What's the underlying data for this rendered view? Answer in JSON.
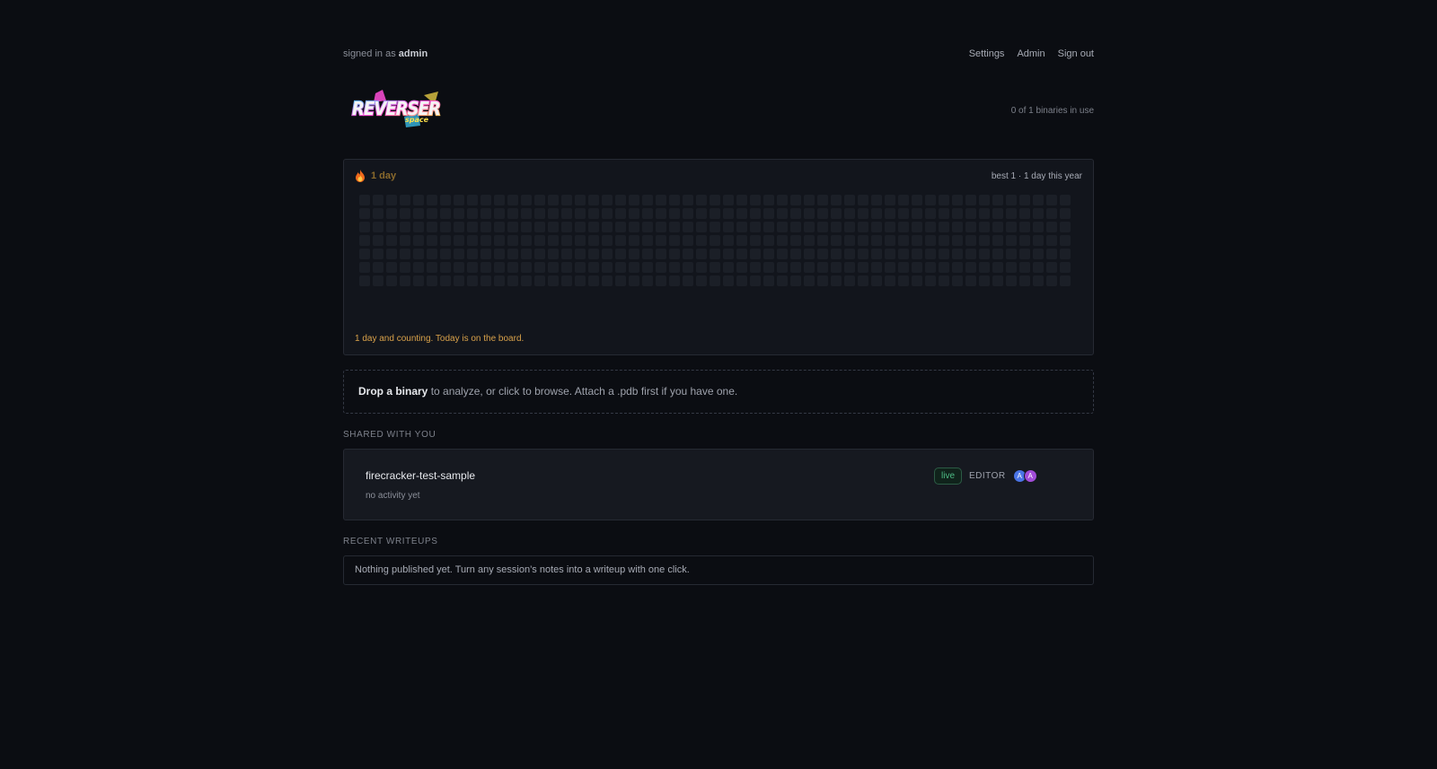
{
  "header": {
    "signed_in_prefix": "signed in as",
    "username": "admin",
    "nav": {
      "settings": "Settings",
      "admin": "Admin",
      "sign_out": "Sign out"
    },
    "logo_text": "REVERSER",
    "logo_subtext": "space",
    "binaries_usage": "0 of 1 binaries in use"
  },
  "streak": {
    "icon": "flame-icon",
    "current": "1 day",
    "summary": "best 1 · 1 day this year",
    "message": "1 day and counting. Today is on the board.",
    "calendar": {
      "weeks": 53,
      "days_per_week": 7,
      "empty_color": "#1b1f27"
    }
  },
  "dropzone": {
    "bold": "Drop a binary",
    "rest": " to analyze, or click to browse. Attach a .pdb first if you have one."
  },
  "shared": {
    "label": "SHARED WITH YOU",
    "items": [
      {
        "name": "firecracker-test-sample",
        "activity": "no activity yet",
        "status": "live",
        "role": "EDITOR",
        "avatars": [
          "A",
          "A"
        ]
      }
    ]
  },
  "writeups": {
    "label": "RECENT WRITEUPS",
    "empty": "Nothing published yet. Turn any session’s notes into a writeup with one click."
  },
  "colors": {
    "background": "#0b0d12",
    "streak_accent": "#d9a24a",
    "live_green": "#4dbb84",
    "avatar_blue": "#4a74e6",
    "avatar_purple": "#a24cd8"
  }
}
